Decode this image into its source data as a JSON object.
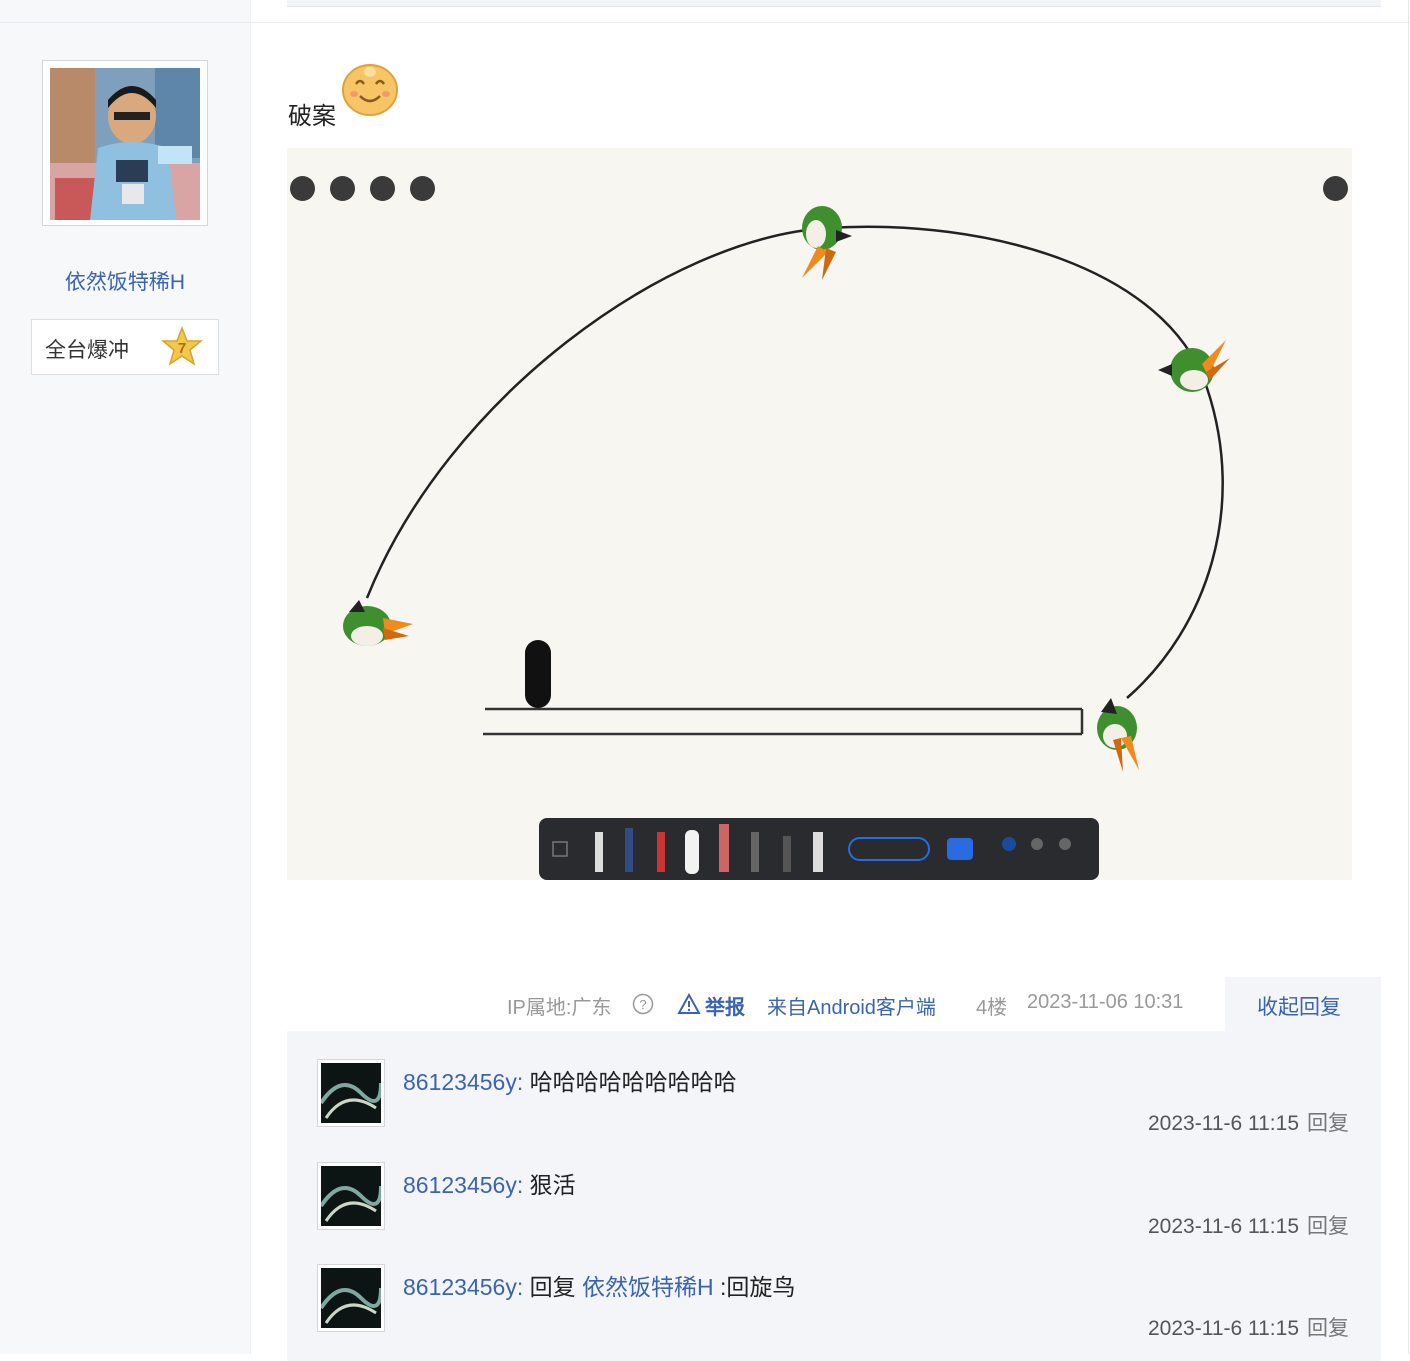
{
  "user": {
    "name": "依然饭特稀H",
    "badge_label": "全台爆冲",
    "badge_level": "7"
  },
  "post": {
    "text": "破案",
    "meta": {
      "ip_location": "IP属地:广东",
      "report": "举报",
      "source": "来自Android客户端",
      "floor": "4楼",
      "time": "2023-11-06 10:31"
    },
    "collapse_label": "收起回复"
  },
  "replies": [
    {
      "user": "86123456y",
      "sep": ": ",
      "content": "哈哈哈哈哈哈哈哈哈",
      "time": "2023-11-6 11:15",
      "reply_label": "回复"
    },
    {
      "user": "86123456y",
      "sep": ": ",
      "content": "狠活",
      "time": "2023-11-6 11:15",
      "reply_label": "回复"
    },
    {
      "user": "86123456y",
      "sep": ": ",
      "content_prefix": "回复 ",
      "mention": "依然饭特稀H",
      "content": " :回旋鸟",
      "time": "2023-11-6 11:15",
      "reply_label": "回复"
    }
  ],
  "colors": {
    "link": "#3b64b0",
    "meta_gray": "#999999",
    "reply_bg": "#f3f5f8",
    "canvas_bg": "#f8f6f1"
  },
  "icons": [
    "star-badge-icon",
    "smile-emoji-icon",
    "question-icon",
    "warning-icon",
    "bird-icon",
    "toolbar-icon"
  ]
}
